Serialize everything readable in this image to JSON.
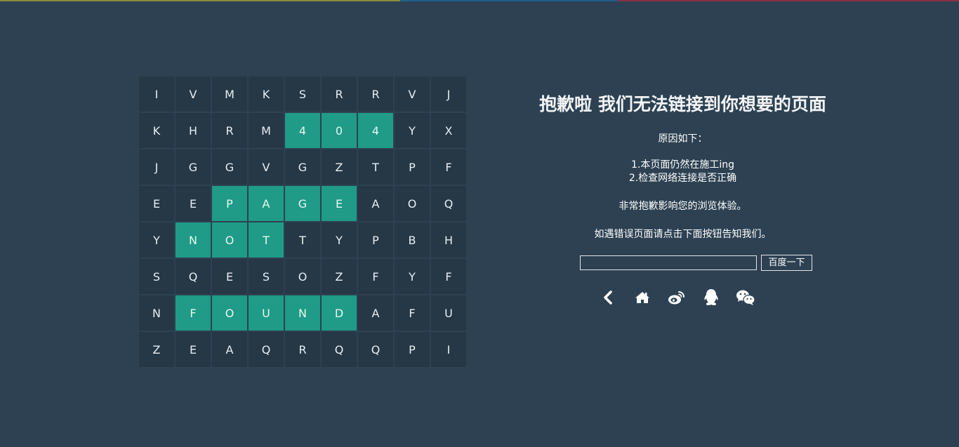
{
  "grid": {
    "rows": [
      [
        "I",
        "V",
        "M",
        "K",
        "S",
        "R",
        "R",
        "V",
        "J"
      ],
      [
        "K",
        "H",
        "R",
        "M",
        "4",
        "0",
        "4",
        "Y",
        "X"
      ],
      [
        "J",
        "G",
        "G",
        "V",
        "G",
        "Z",
        "T",
        "P",
        "F"
      ],
      [
        "E",
        "E",
        "P",
        "A",
        "G",
        "E",
        "A",
        "O",
        "Q"
      ],
      [
        "Y",
        "N",
        "O",
        "T",
        "T",
        "Y",
        "P",
        "B",
        "H"
      ],
      [
        "S",
        "Q",
        "E",
        "S",
        "O",
        "Z",
        "F",
        "Y",
        "F"
      ],
      [
        "N",
        "F",
        "O",
        "U",
        "N",
        "D",
        "A",
        "F",
        "U"
      ],
      [
        "Z",
        "E",
        "A",
        "Q",
        "R",
        "Q",
        "Q",
        "P",
        "I"
      ]
    ],
    "highlighted": [
      [
        1,
        4
      ],
      [
        1,
        5
      ],
      [
        1,
        6
      ],
      [
        3,
        2
      ],
      [
        3,
        3
      ],
      [
        3,
        4
      ],
      [
        3,
        5
      ],
      [
        4,
        1
      ],
      [
        4,
        2
      ],
      [
        4,
        3
      ],
      [
        6,
        1
      ],
      [
        6,
        2
      ],
      [
        6,
        3
      ],
      [
        6,
        4
      ],
      [
        6,
        5
      ]
    ],
    "highlight_color": "#1f9b87"
  },
  "message": {
    "title": "抱歉啦 我们无法链接到你想要的页面",
    "reason_head": "原因如下：",
    "reason_1": "1.本页面仍然在施工ing",
    "reason_2": "2.检查网络连接是否正确",
    "apology": "非常抱歉影响您的浏览体验。",
    "contact": "如遇错误页面请点击下面按钮告知我们。"
  },
  "search": {
    "value": "",
    "button_label": "百度一下"
  },
  "icons": [
    "back-icon",
    "home-icon",
    "weibo-icon",
    "qq-icon",
    "wechat-icon"
  ],
  "colors": {
    "background": "#2d4152",
    "cell": "#263846",
    "accent": "#1f9b87"
  }
}
